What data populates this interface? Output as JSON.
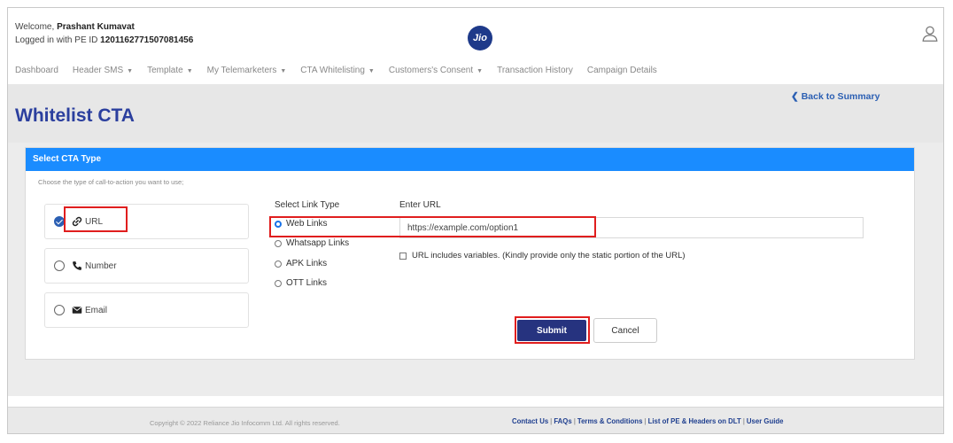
{
  "header": {
    "welcome_prefix": "Welcome, ",
    "user_name": "Prashant Kumavat",
    "logged_prefix": "Logged in with PE ID ",
    "pe_id": "1201162771507081456",
    "logo_text": "Jio"
  },
  "nav": [
    {
      "label": "Dashboard",
      "dropdown": false
    },
    {
      "label": "Header SMS",
      "dropdown": true
    },
    {
      "label": "Template",
      "dropdown": true
    },
    {
      "label": "My Telemarketers",
      "dropdown": true
    },
    {
      "label": "CTA Whitelisting",
      "dropdown": true
    },
    {
      "label": "Customers's Consent",
      "dropdown": true
    },
    {
      "label": "Transaction History",
      "dropdown": false
    },
    {
      "label": "Campaign Details",
      "dropdown": false
    }
  ],
  "page": {
    "title": "Whitelist CTA",
    "back_label": "❮ Back to Summary"
  },
  "card": {
    "header": "Select CTA Type",
    "choose_text": "Choose the type of call-to-action you want to use;",
    "options": [
      {
        "label": "URL",
        "icon": "link-icon",
        "selected": true
      },
      {
        "label": "Number",
        "icon": "phone-icon",
        "selected": false
      },
      {
        "label": "Email",
        "icon": "envelope-icon",
        "selected": false
      }
    ],
    "link_type_label": "Select Link Type",
    "link_types": [
      {
        "label": "Web Links",
        "selected": true
      },
      {
        "label": "Whatsapp Links",
        "selected": false
      },
      {
        "label": "APK Links",
        "selected": false
      },
      {
        "label": "OTT Links",
        "selected": false
      }
    ],
    "url_label": "Enter URL",
    "url_value": "https://example.com/option1",
    "checkbox_label": "URL includes variables. (Kindly provide only the static portion of the URL)",
    "submit_label": "Submit",
    "cancel_label": "Cancel"
  },
  "footer": {
    "copyright": "Copyright © 2022 Reliance Jio Infocomm Ltd. All rights reserved.",
    "links": [
      "Contact Us",
      "FAQs",
      "Terms & Conditions",
      "List of PE & Headers on DLT",
      "User Guide"
    ]
  },
  "colors": {
    "accent": "#1a8cff",
    "title": "#2b3f9e",
    "submit": "#26337f",
    "highlight": "#e01e1e"
  }
}
